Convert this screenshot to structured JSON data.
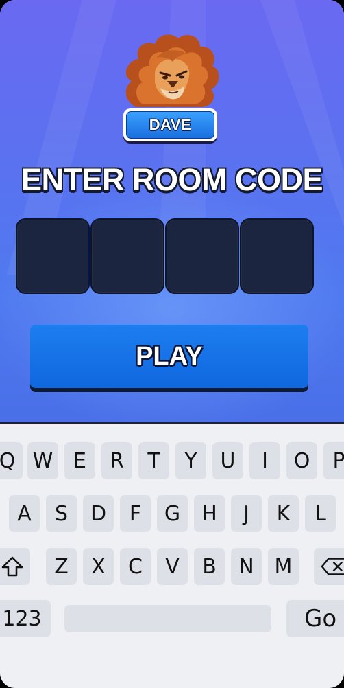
{
  "player": {
    "name": "DAVE",
    "avatar": "lion-avatar"
  },
  "title": "ENTER ROOM CODE",
  "code_boxes": [
    "",
    "",
    "",
    ""
  ],
  "play_button": {
    "label": "PLAY"
  },
  "keyboard": {
    "row1": [
      "Q",
      "W",
      "E",
      "R",
      "T",
      "Y",
      "U",
      "I",
      "O",
      "P"
    ],
    "row2": [
      "A",
      "S",
      "D",
      "F",
      "G",
      "H",
      "J",
      "K",
      "L"
    ],
    "row3": [
      "Z",
      "X",
      "C",
      "V",
      "B",
      "N",
      "M"
    ],
    "shift_icon": "shift-icon",
    "backspace_icon": "backspace-icon",
    "numbers_label": "123",
    "space_label": "",
    "go_label": "Go"
  },
  "colors": {
    "accent": "#1a6fe0",
    "background_top": "#6a69f2",
    "code_box": "#1b2540"
  }
}
